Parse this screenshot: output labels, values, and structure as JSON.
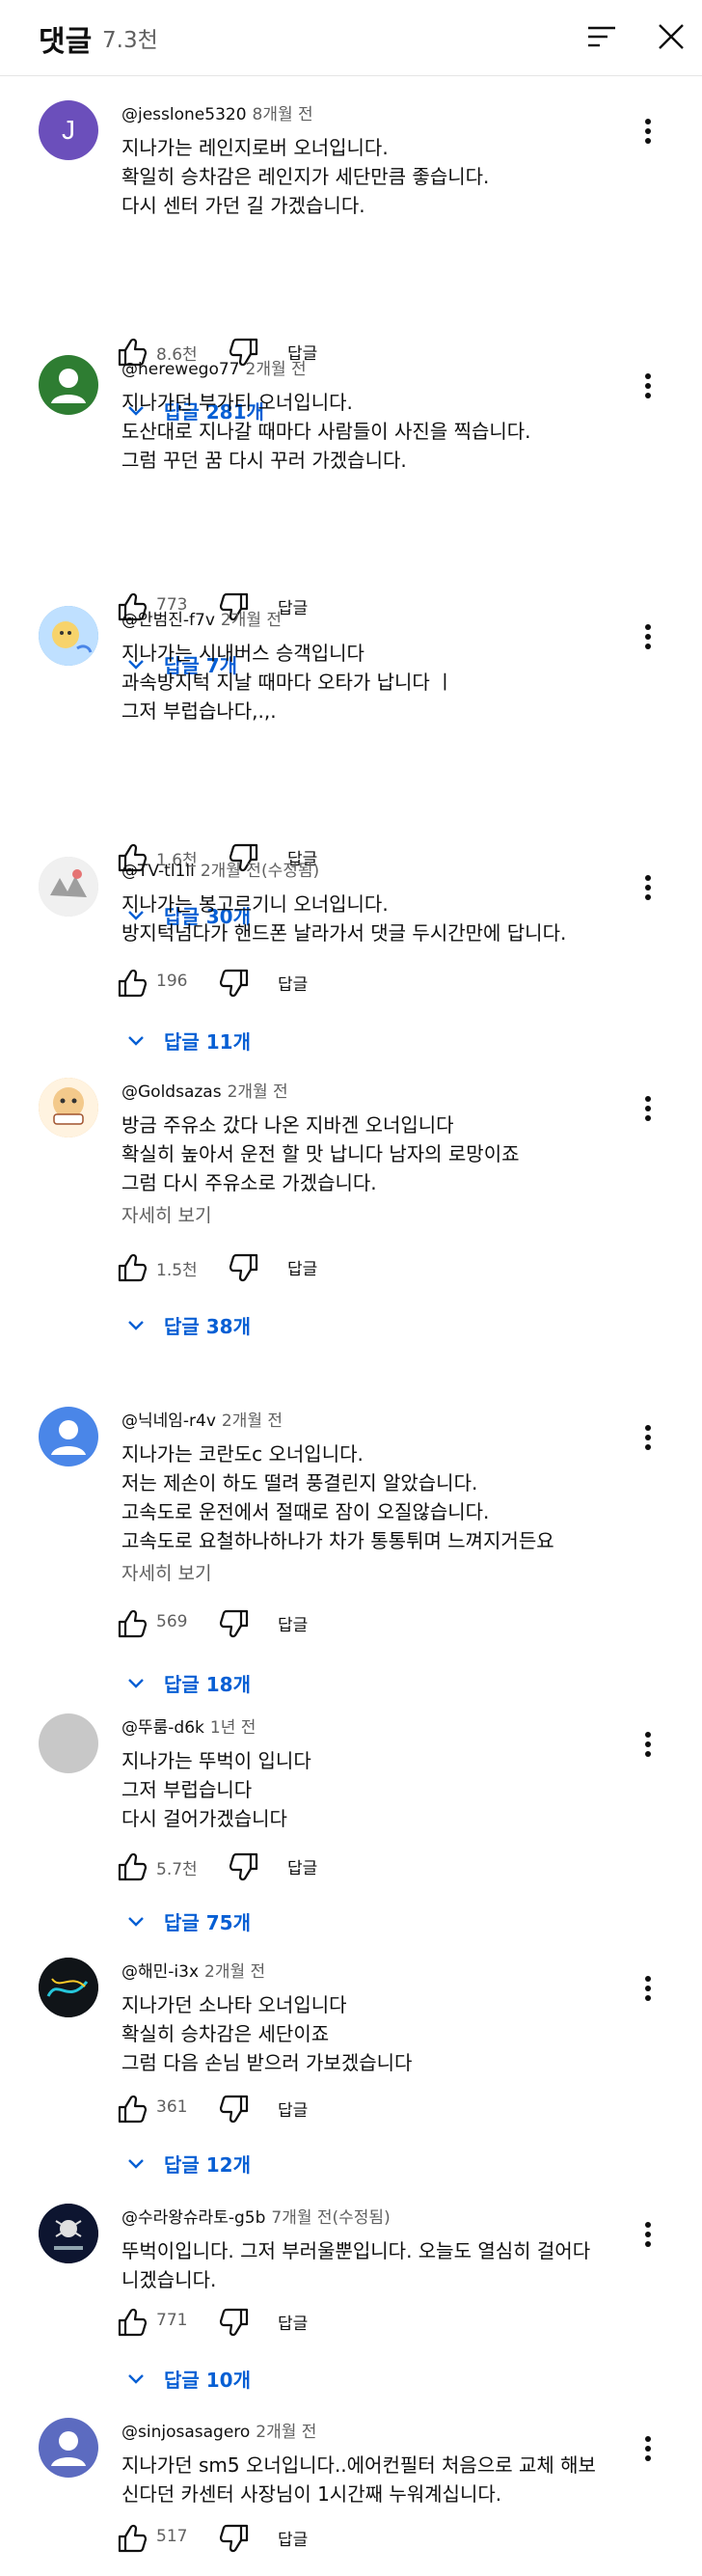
{
  "header": {
    "title": "댓글",
    "count": "7.3천",
    "sort_icon": "sort-icon",
    "close_icon": "close-icon"
  },
  "comments": [
    {
      "author": "@jesslone5320",
      "time": "8개월 전",
      "avatar_initial": "J",
      "avatar_color": "#6b4fbb",
      "lines": [
        "지나가는 레인지로버 오너입니다.",
        "확일히 승차감은 레인지가 세단만큼 좋습니다.",
        "다시 센터 가던 길 가겠습니다."
      ],
      "likes": "8.6천",
      "reply_label": "답글",
      "replies": "답글 281개"
    },
    {
      "author": "@herewego77",
      "time": "2개월 전",
      "avatar_color": "#2e7d32",
      "lines": [
        "지나가던 부가티 오너입니다.",
        "도산대로 지나갈 때마다 사람들이 사진을 찍습니다.",
        "그럼 꾸던 꿈 다시 꾸러 가겠습니다."
      ],
      "likes": "773",
      "reply_label": "답글",
      "replies": "답글 7개"
    },
    {
      "author": "@안범진-f7v",
      "time": "2개월 전",
      "avatar_color": "#7ab6e8",
      "lines": [
        "지나가는 시내버스 승객입니다",
        "과속방지턱 지날 때마다 오타가 납니다 ㅣ",
        "그저 부럽습나다,.,."
      ],
      "likes": "1.6천",
      "reply_label": "답글",
      "replies": "답글 30개"
    },
    {
      "author": "@TV-tl1li",
      "time": "2개월 전(수정됨)",
      "avatar_color": "#e0e0e0",
      "lines": [
        "지나가는 봉고르기니 오너입니다.",
        "방지턱넘다가 핸드폰 날라가서 댓글 두시간만에 답니다."
      ],
      "likes": "196",
      "reply_label": "답글",
      "replies": "답글 11개"
    },
    {
      "author": "@Goldsazas",
      "time": "2개월 전",
      "avatar_color": "#f3c98b",
      "lines": [
        "방금 주유소 갔다 나온 지바겐 오너입니다",
        "확실히 높아서 운전 할 맛 납니다 남자의 로망이죠",
        "그럼 다시 주유소로 가겠습니다."
      ],
      "read_more": "자세히 보기",
      "likes": "1.5천",
      "reply_label": "답글",
      "replies": "답글 38개"
    },
    {
      "author": "@닉네임-r4v",
      "time": "2개월 전",
      "avatar_color": "#4a86e8",
      "lines": [
        "지나가는 코란도c 오너입니다.",
        "저는 제손이 하도 떨려 풍결린지 알았습니다.",
        "고속도로 운전에서 절때로 잠이 오질않습니다.",
        "고속도로 요철하나하나가 차가 통통튀며 느껴지거든요"
      ],
      "read_more": "자세히 보기",
      "likes": "569",
      "reply_label": "답글",
      "replies": "답글 18개"
    },
    {
      "author": "@뚜룸-d6k",
      "time": "1년 전",
      "avatar_color": "#c8c8c8",
      "lines": [
        "지나가는 뚜벅이 입니다",
        "그저 부럽습니다",
        "다시 걸어가겠습니다"
      ],
      "likes": "5.7천",
      "reply_label": "답글",
      "replies": "답글 75개"
    },
    {
      "author": "@해민-i3x",
      "time": "2개월 전",
      "avatar_color": "#101418",
      "lines": [
        "지나가던 소나타 오너입니다",
        "확실히 승차감은 세단이죠",
        "그럼 다음 손님 받으러 가보겠습니다"
      ],
      "likes": "361",
      "reply_label": "답글",
      "replies": "답글 12개"
    },
    {
      "author": "@수라왕슈라토-g5b",
      "time": "7개월 전(수정됨)",
      "avatar_color": "#0d1530",
      "lines": [
        "뚜벅이입니다. 그저 부러울뿐입니다. 오늘도 열심히 걸어다",
        "니겠습니다."
      ],
      "likes": "771",
      "reply_label": "답글",
      "replies": "답글 10개"
    },
    {
      "author": "@sinjosasagero",
      "time": "2개월 전",
      "avatar_color": "#5c6bc0",
      "lines": [
        "지나가던 sm5 오너입니다..에어컨필터 처음으로 교체 해보",
        "신다던 카센터 사장님이 1시간째 누워계십니다."
      ],
      "likes": "517",
      "reply_label": "답글"
    }
  ]
}
